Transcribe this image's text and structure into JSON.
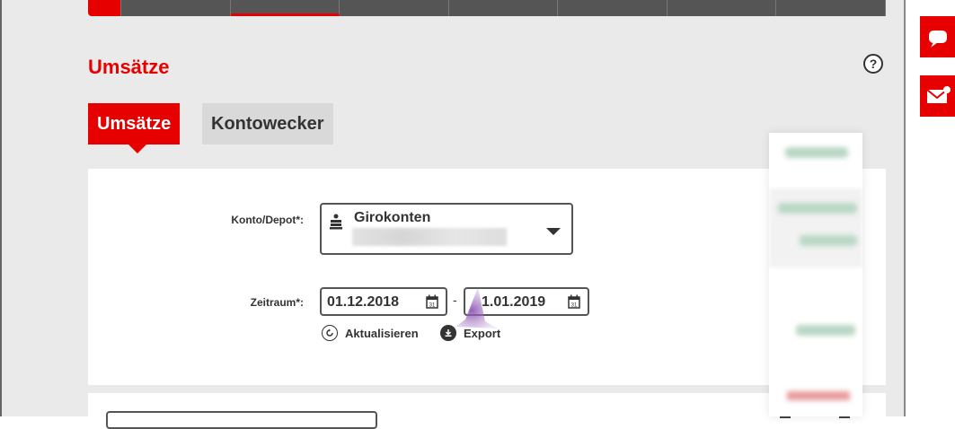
{
  "header": {
    "title": "Umsätze",
    "help_label": "?"
  },
  "tabs": [
    {
      "label": "Umsätze",
      "active": true
    },
    {
      "label": "Kontowecker",
      "active": false
    }
  ],
  "form": {
    "account_label": "Konto/Depot*:",
    "account_type": "Girokonten",
    "period_label": "Zeitraum*:",
    "date_from": "01.12.2018",
    "date_separator": "-",
    "date_to": "1.01.2019",
    "refresh_label": "Aktualisieren",
    "export_label": "Export"
  },
  "colors": {
    "accent": "#e60000",
    "nav": "#555555"
  },
  "icons": [
    "help-icon",
    "bank-icon",
    "chevron-down-icon",
    "calendar-icon",
    "refresh-icon",
    "download-icon",
    "chat-icon",
    "mail-icon"
  ]
}
